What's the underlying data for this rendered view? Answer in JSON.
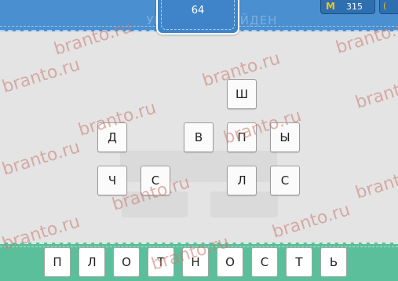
{
  "header": {
    "level": "64",
    "title_faded": "УРОВЕНЬ ПРОЙДЕН",
    "coins_icon": "М",
    "coins": "315",
    "extra_icon": "("
  },
  "tiles": [
    {
      "name": "tile-sh",
      "letter": "Ш"
    },
    {
      "name": "tile-d",
      "letter": "Д"
    },
    {
      "name": "tile-v",
      "letter": "В"
    },
    {
      "name": "tile-p",
      "letter": "П"
    },
    {
      "name": "tile-y",
      "letter": "Ы"
    },
    {
      "name": "tile-ch",
      "letter": "Ч"
    },
    {
      "name": "tile-s1",
      "letter": "С"
    },
    {
      "name": "tile-l",
      "letter": "Л"
    },
    {
      "name": "tile-s2",
      "letter": "С"
    }
  ],
  "answer": [
    "П",
    "Л",
    "О",
    "Т",
    "Н",
    "О",
    "С",
    "Т",
    "Ь"
  ],
  "watermark": "branto.ru",
  "colors": {
    "top": "#4a8fd0",
    "bottom": "#5cbf9c",
    "background": "#e4e4e4",
    "coin": "#f2c21b"
  }
}
